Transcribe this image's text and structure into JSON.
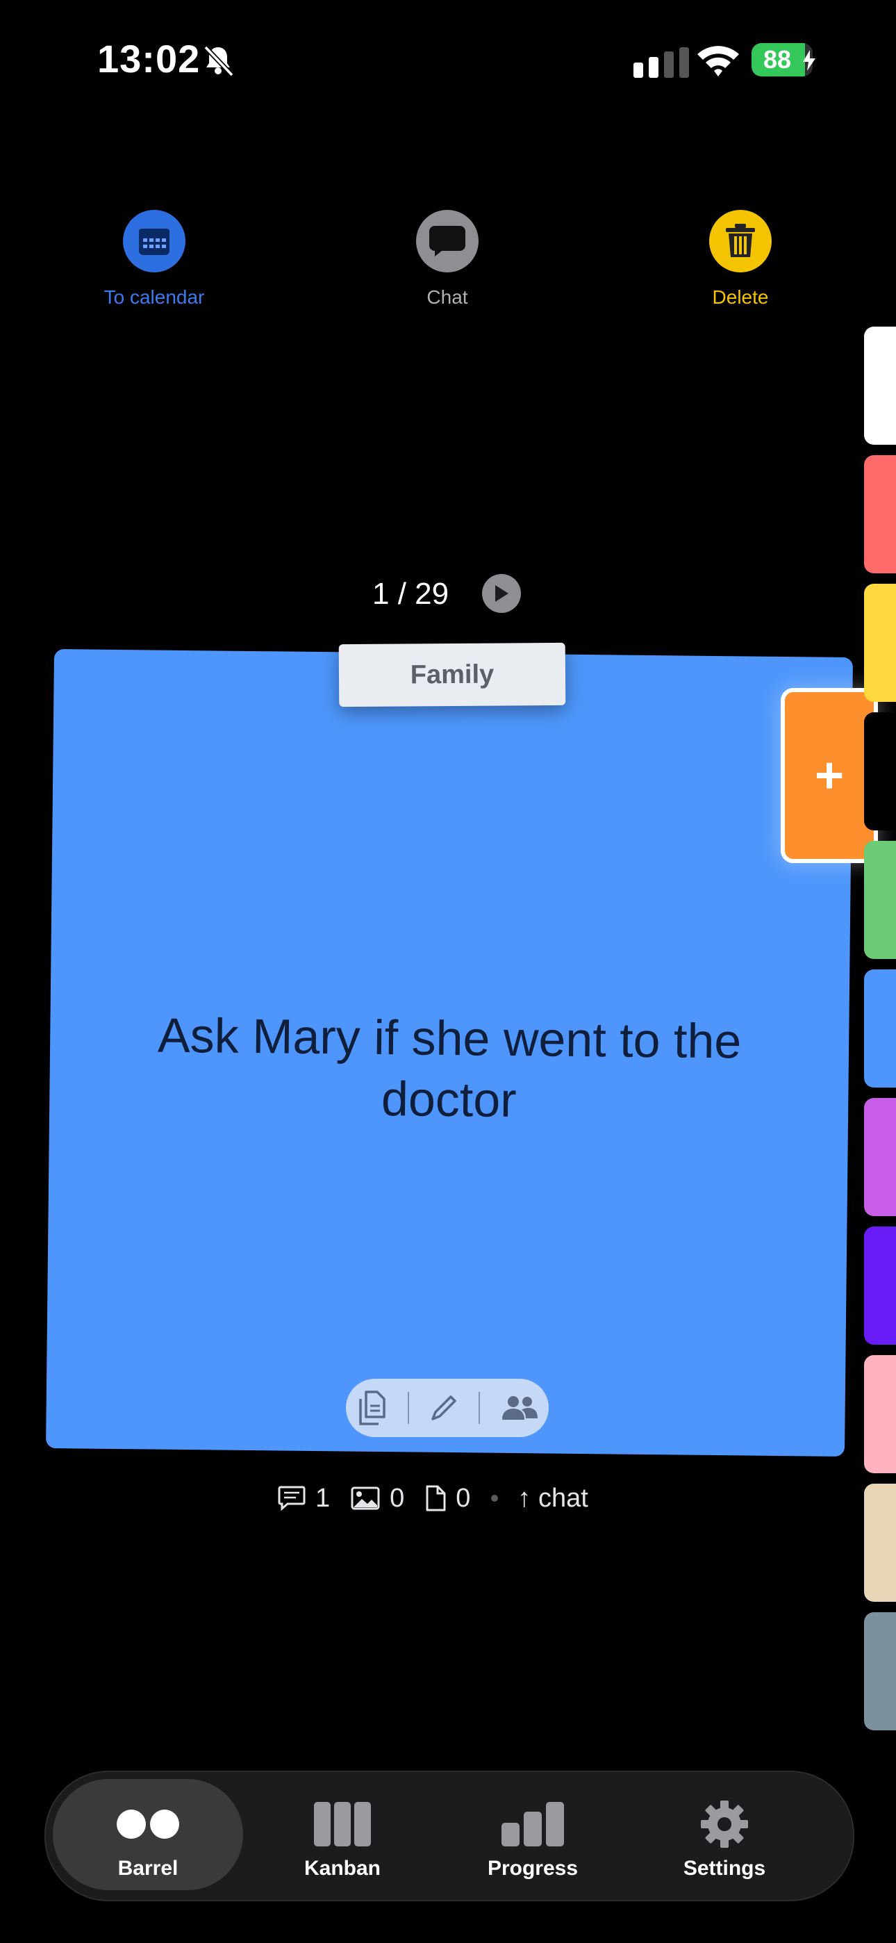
{
  "status_bar": {
    "time": "13:02",
    "battery_percent": "88",
    "battery_level": 0.88
  },
  "actions": {
    "calendar_label": "To calendar",
    "chat_label": "Chat",
    "delete_label": "Delete"
  },
  "counter": {
    "current": 1,
    "total": 29,
    "text": "1 / 29"
  },
  "card": {
    "tag": "Family",
    "text": "Ask Mary if she went to the doctor",
    "color": "#4e96fb"
  },
  "add_button": {
    "label": "+"
  },
  "color_tabs": [
    "#ffffff",
    "#ff6b6b",
    "#ffd93d",
    "#000000",
    "#6bcb77",
    "#4e96fb",
    "#c85de8",
    "#6a1cf6",
    "#ffb3c1",
    "#e8d5b7",
    "#7b929e"
  ],
  "stats": {
    "comments": "1",
    "images": "0",
    "files": "0",
    "chat_link": "↑ chat"
  },
  "nav": {
    "items": [
      {
        "label": "Barrel",
        "active": true
      },
      {
        "label": "Kanban",
        "active": false
      },
      {
        "label": "Progress",
        "active": false
      },
      {
        "label": "Settings",
        "active": false
      }
    ]
  },
  "colors": {
    "calendar_blue": "#2d6fe0",
    "chat_gray": "#8e8e93",
    "delete_yellow": "#f5c400",
    "accent_orange": "#fd8f2d"
  }
}
